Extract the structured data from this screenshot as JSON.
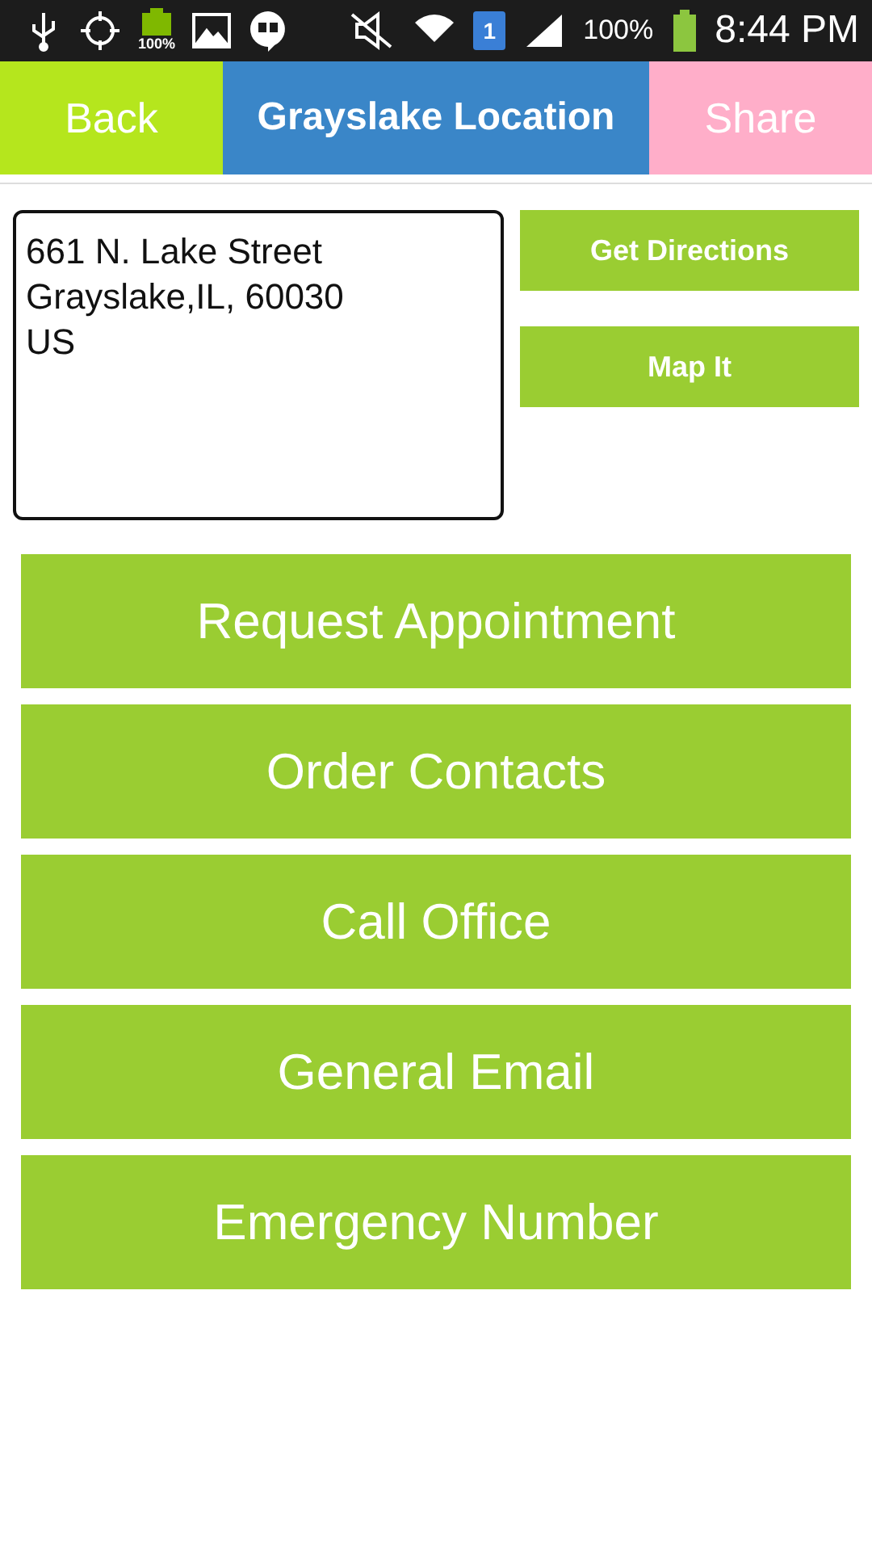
{
  "status_bar": {
    "battery_small": "100%",
    "sim_badge": "1",
    "battery_percent": "100%",
    "time": "8:44 PM"
  },
  "header": {
    "back": "Back",
    "title": "Grayslake Location",
    "share": "Share"
  },
  "address": {
    "lines": [
      "661 N. Lake Street",
      "Grayslake,IL, 60030",
      "US"
    ]
  },
  "side_buttons": [
    "Get Directions",
    "Map It"
  ],
  "actions": [
    "Request Appointment",
    "Order Contacts",
    "Call Office",
    "General Email",
    "Emergency Number"
  ]
}
